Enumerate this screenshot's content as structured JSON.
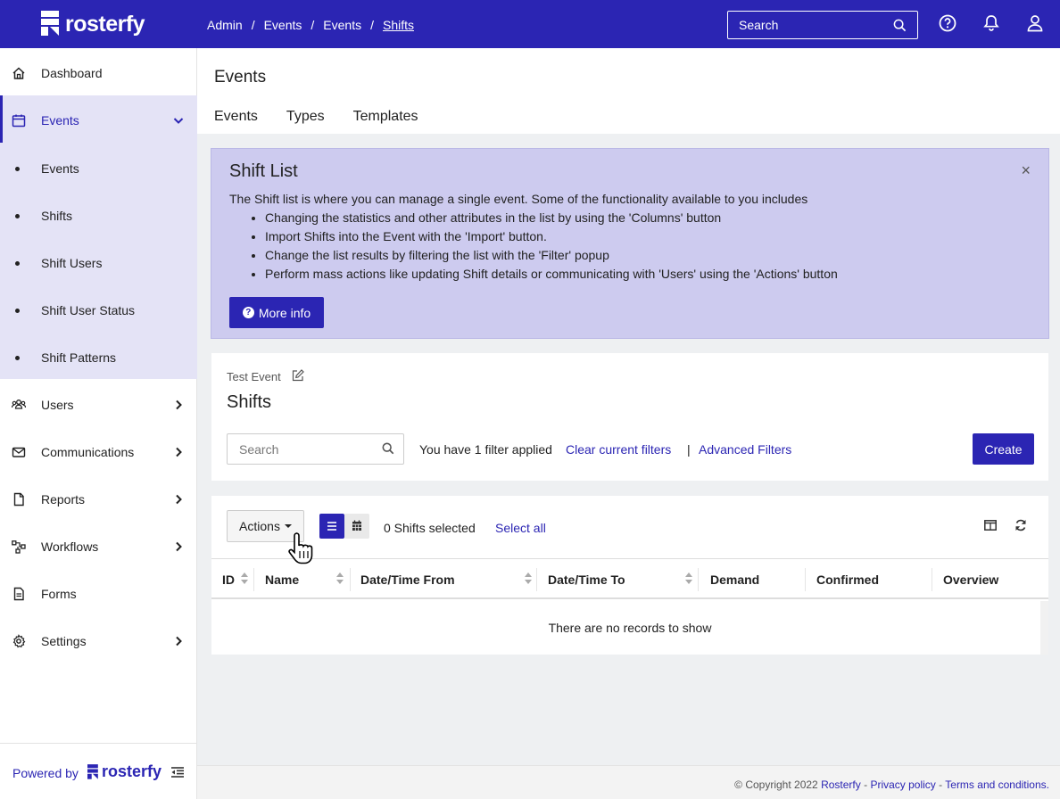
{
  "app": {
    "brand": "rosterfy"
  },
  "header": {
    "breadcrumb": [
      "Admin",
      "Events",
      "Events",
      "Shifts"
    ],
    "search_placeholder": "Search"
  },
  "sidebar": {
    "items": [
      {
        "label": "Dashboard",
        "icon": "home-icon"
      },
      {
        "label": "Events",
        "icon": "calendar-icon"
      },
      {
        "label": "Users",
        "icon": "users-icon"
      },
      {
        "label": "Communications",
        "icon": "mail-icon"
      },
      {
        "label": "Reports",
        "icon": "file-icon"
      },
      {
        "label": "Workflows",
        "icon": "workflow-icon"
      },
      {
        "label": "Forms",
        "icon": "form-icon"
      },
      {
        "label": "Settings",
        "icon": "gear-icon"
      }
    ],
    "sub_items": [
      "Events",
      "Shifts",
      "Shift Users",
      "Shift User Status",
      "Shift Patterns"
    ],
    "powered_by": "Powered by",
    "powered_brand": "rosterfy"
  },
  "page": {
    "title": "Events",
    "tabs": [
      "Events",
      "Types",
      "Templates"
    ]
  },
  "info": {
    "title": "Shift List",
    "close": "×",
    "description": "The Shift list is where you can manage a single event. Some of the functionality available to you includes",
    "bullets": [
      "Changing the statistics and other attributes in the list by using the 'Columns' button",
      "Import Shifts into the Event with the 'Import' button.",
      "Change the list results by filtering the list with the 'Filter' popup",
      "Perform mass actions like updating Shift details or communicating with 'Users' using the 'Actions' button"
    ],
    "more_info": "More info"
  },
  "shifts_card": {
    "event_name": "Test Event",
    "title": "Shifts",
    "search_placeholder": "Search",
    "filter_text": "You have 1 filter applied",
    "clear_filters": "Clear current filters",
    "separator": "|",
    "advanced_filters": "Advanced Filters",
    "create": "Create"
  },
  "table_card": {
    "actions": "Actions",
    "selected": "0 Shifts selected",
    "select_all": "Select all",
    "columns": [
      "ID",
      "Name",
      "Date/Time From",
      "Date/Time To",
      "Demand",
      "Confirmed",
      "Overview"
    ],
    "empty": "There are no records to show"
  },
  "footer": {
    "copyright": "© Copyright 2022",
    "brand": "Rosterfy",
    "dash": "-",
    "privacy": "Privacy policy",
    "terms": "Terms and conditions."
  },
  "colors": {
    "brand": "#2b25b3",
    "highlight": "#e4e3f6",
    "info_bg": "#cdcbef"
  }
}
